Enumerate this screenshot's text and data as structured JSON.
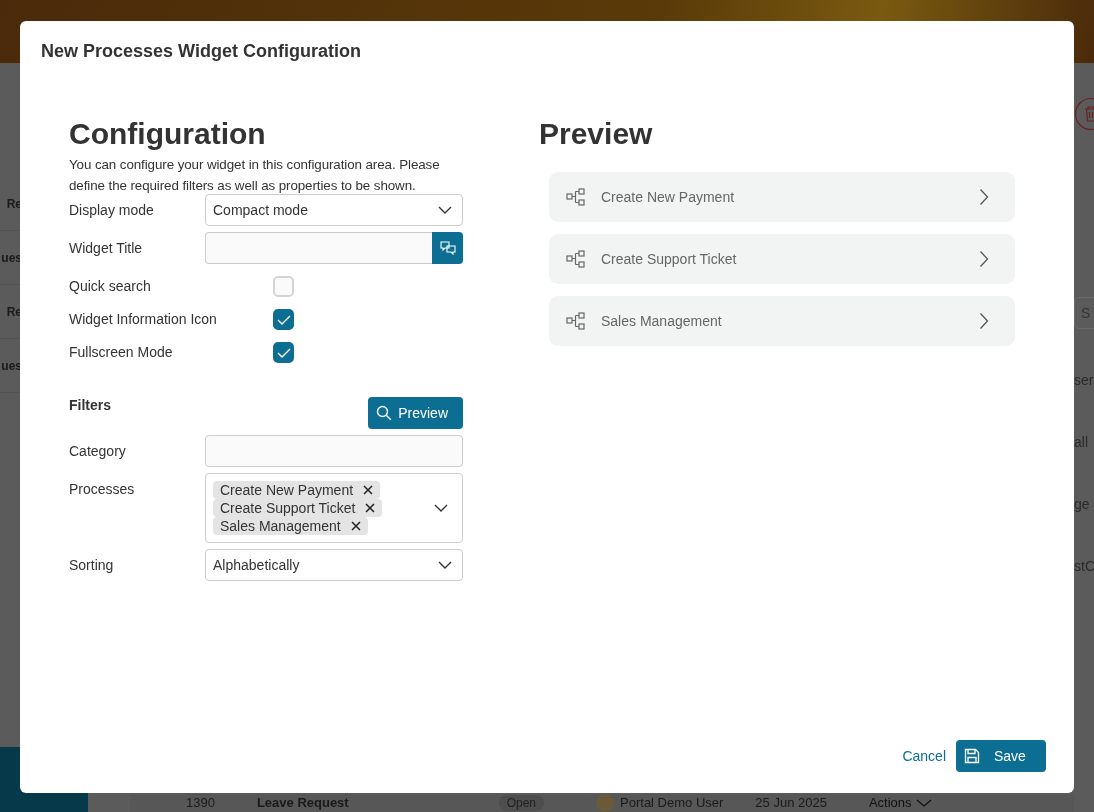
{
  "background": {
    "left_column": [
      "Re",
      "ues",
      "Re",
      "ues"
    ],
    "right_column": [
      {
        "kind": "search",
        "text": "S"
      },
      {
        "kind": "text",
        "text": "ser"
      },
      {
        "kind": "text",
        "text": "all"
      },
      {
        "kind": "text",
        "text": "ge"
      },
      {
        "kind": "text",
        "text": "stC"
      }
    ],
    "table_row": {
      "id": "1390",
      "name": "Leave Request",
      "state": "Open",
      "user": "Portal Demo User",
      "date": "25 Jun 2025",
      "actions": "Actions"
    }
  },
  "dialog": {
    "title": "New Processes Widget Configuration",
    "configuration": {
      "heading": "Configuration",
      "description": "You can configure your widget in this configuration area. Please define the required filters as well as properties to be shown.",
      "fields": [
        {
          "kind": "select",
          "label": "Display mode",
          "value": "Compact mode"
        },
        {
          "kind": "translatable",
          "label": "Widget Title"
        },
        {
          "kind": "checkbox",
          "label": "Quick search",
          "checked": false
        },
        {
          "kind": "checkbox",
          "label": "Widget Information Icon",
          "checked": true
        },
        {
          "kind": "checkbox",
          "label": "Fullscreen Mode",
          "checked": true
        }
      ]
    },
    "filters": {
      "heading": "Filters",
      "preview_button": "Preview",
      "fields": [
        {
          "kind": "text",
          "label": "Category"
        },
        {
          "kind": "multiselect",
          "label": "Processes",
          "tags": [
            "Create New Payment",
            "Create Support Ticket",
            "Sales Management"
          ]
        },
        {
          "kind": "select",
          "label": "Sorting",
          "value": "Alphabetically"
        }
      ]
    },
    "preview": {
      "heading": "Preview",
      "items": [
        "Create New Payment",
        "Create Support Ticket",
        "Sales Management"
      ]
    },
    "buttons": {
      "cancel": "Cancel",
      "save": "Save"
    }
  }
}
